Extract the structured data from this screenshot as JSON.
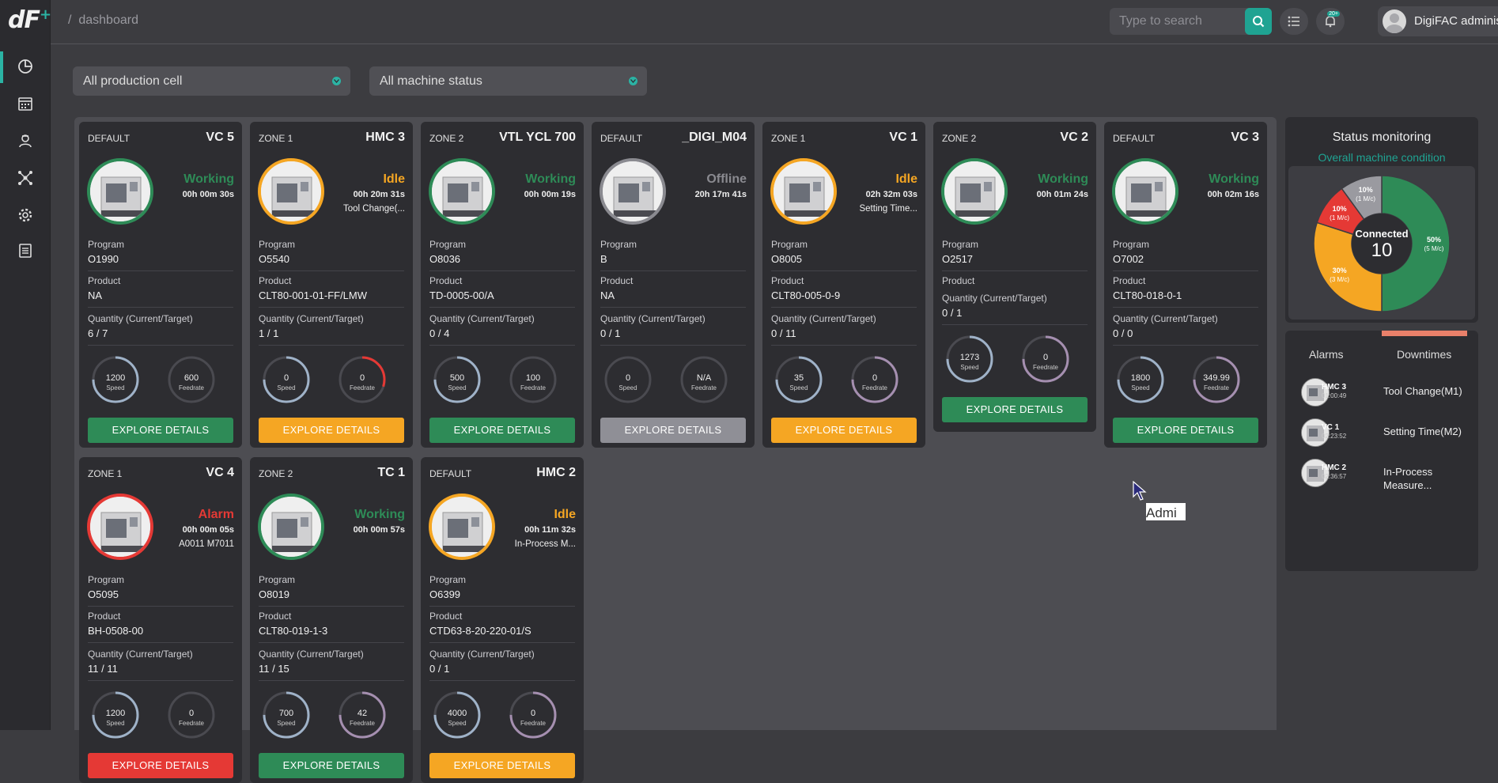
{
  "brand": {
    "logo": "dF",
    "logo_sup": "+"
  },
  "breadcrumb": {
    "sep": "/",
    "page": "dashboard"
  },
  "search": {
    "placeholder": "Type to search"
  },
  "notifications": {
    "badge": "20+"
  },
  "user": {
    "name": "DigiFAC administrator"
  },
  "filters": {
    "production_cell": "All production cell",
    "machine_status": "All machine status"
  },
  "labels": {
    "program": "Program",
    "product": "Product",
    "quantity": "Quantity (Current/Target)",
    "speed": "Speed",
    "feedrate": "Feedrate",
    "explore": "EXPLORE DETAILS"
  },
  "colors": {
    "working": "#2e8b57",
    "idle": "#f5a623",
    "offline": "#8a8a90",
    "alarm": "#e53935",
    "accent": "#1fa392"
  },
  "machines": [
    {
      "zone": "DEFAULT",
      "name": "VC 5",
      "status": "Working",
      "state": "working",
      "time": "00h 00m 30s",
      "sub": "",
      "program": "O1990",
      "product": "NA",
      "quantity": "6 / 7",
      "speed": "1200",
      "speed_pct": 0.75,
      "feedrate": "600",
      "feed_pct": 0.0
    },
    {
      "zone": "ZONE 1",
      "name": "HMC 3",
      "status": "Idle",
      "state": "idle",
      "time": "00h 20m 31s",
      "sub": "Tool Change(...",
      "program": "O5540",
      "product": "CLT80-001-01-FF/LMW",
      "quantity": "1 / 1",
      "speed": "0",
      "speed_pct": 0.75,
      "feedrate": "0",
      "feed_pct": 0.3
    },
    {
      "zone": "ZONE 2",
      "name": "VTL YCL 700",
      "status": "Working",
      "state": "working",
      "time": "00h 00m 19s",
      "sub": "",
      "program": "O8036",
      "product": "TD-0005-00/A",
      "quantity": "0 / 4",
      "speed": "500",
      "speed_pct": 0.75,
      "feedrate": "100",
      "feed_pct": 0.0
    },
    {
      "zone": "DEFAULT",
      "name": "_DIGI_M04",
      "status": "Offline",
      "state": "offline",
      "time": "20h 17m 41s",
      "sub": "",
      "program": "B",
      "product": "NA",
      "quantity": "0 / 1",
      "speed": "0",
      "speed_pct": 0.0,
      "feedrate": "N/A",
      "feed_pct": 0.0
    },
    {
      "zone": "ZONE 1",
      "name": "VC 1",
      "status": "Idle",
      "state": "idle",
      "time": "02h 32m 03s",
      "sub": "Setting Time...",
      "program": "O8005",
      "product": "CLT80-005-0-9",
      "quantity": "0 / 11",
      "speed": "35",
      "speed_pct": 0.75,
      "feedrate": "0",
      "feed_pct": 0.75
    },
    {
      "zone": "ZONE 2",
      "name": "VC 2",
      "status": "Working",
      "state": "working",
      "time": "00h 01m 24s",
      "sub": "",
      "program": "O2517",
      "product": "",
      "quantity": "0 / 1",
      "speed": "1273",
      "speed_pct": 0.75,
      "feedrate": "0",
      "feed_pct": 0.75
    },
    {
      "zone": "DEFAULT",
      "name": "VC 3",
      "status": "Working",
      "state": "working",
      "time": "00h 02m 16s",
      "sub": "",
      "program": "O7002",
      "product": "CLT80-018-0-1",
      "quantity": "0 / 0",
      "speed": "1800",
      "speed_pct": 0.75,
      "feedrate": "349.99",
      "feed_pct": 0.75
    },
    {
      "zone": "ZONE 1",
      "name": "VC 4",
      "status": "Alarm",
      "state": "alarm",
      "time": "00h 00m 05s",
      "sub": "A0011 M7011",
      "program": "O5095",
      "product": "BH-0508-00",
      "quantity": "11 / 11",
      "speed": "1200",
      "speed_pct": 0.75,
      "feedrate": "0",
      "feed_pct": 0.0
    },
    {
      "zone": "ZONE 2",
      "name": "TC 1",
      "status": "Working",
      "state": "working",
      "time": "00h 00m 57s",
      "sub": "",
      "program": "O8019",
      "product": "CLT80-019-1-3",
      "quantity": "11 / 15",
      "speed": "700",
      "speed_pct": 0.75,
      "feedrate": "42",
      "feed_pct": 0.75
    },
    {
      "zone": "DEFAULT",
      "name": "HMC 2",
      "status": "Idle",
      "state": "idle",
      "time": "00h 11m 32s",
      "sub": "In-Process M...",
      "program": "O6399",
      "product": "CTD63-8-20-220-01/S",
      "quantity": "0 / 1",
      "speed": "4000",
      "speed_pct": 0.75,
      "feedrate": "0",
      "feed_pct": 0.75
    }
  ],
  "status_panel": {
    "title": "Status monitoring",
    "subtitle": "Overall machine condition",
    "center_label": "Connected",
    "center_value": "10"
  },
  "chart_data": {
    "type": "pie",
    "center_label": "Connected",
    "center_value": 10,
    "slices": [
      {
        "label": "50%",
        "sub": "(5 M/c)",
        "value": 50,
        "color": "#2e8b57"
      },
      {
        "label": "30%",
        "sub": "(3 M/c)",
        "value": 30,
        "color": "#f5a623"
      },
      {
        "label": "10%",
        "sub": "(1 M/c)",
        "value": 10,
        "color": "#e53935"
      },
      {
        "label": "10%",
        "sub": "(1 M/c)",
        "value": 10,
        "color": "#9a9aa0"
      }
    ]
  },
  "alarms_panel": {
    "tabs": [
      "Alarms",
      "Downtimes"
    ],
    "rows": [
      {
        "machine": "HMC 3",
        "time": "01:00:49",
        "desc": "Tool Change(M1)"
      },
      {
        "machine": "VC 1",
        "time": "02:23:52",
        "desc": "Setting Time(M2)"
      },
      {
        "machine": "HMC 2",
        "time": "02:36:57",
        "desc": "In-Process Measure..."
      }
    ]
  },
  "tooltip": {
    "text": "Admi"
  }
}
